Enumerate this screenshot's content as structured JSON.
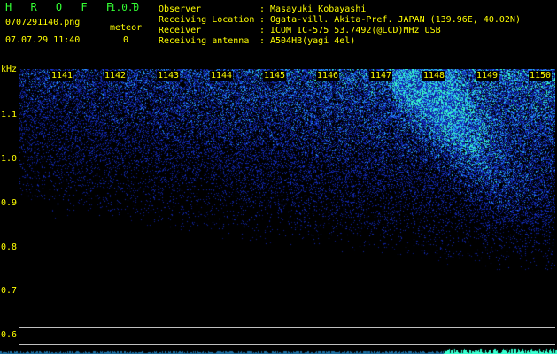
{
  "app": {
    "title": "H R O F F T",
    "version": "1.0.0"
  },
  "file": {
    "name": "0707291140.png",
    "datetime": "07.07.29 11:40"
  },
  "meteor": {
    "label": "meteor",
    "count": "0"
  },
  "info": [
    {
      "label": "Observer",
      "value": "Masayuki Kobayashi"
    },
    {
      "label": "Receiving Location",
      "value": "Ogata-vill. Akita-Pref. JAPAN (139.96E, 40.02N)"
    },
    {
      "label": "Receiver",
      "value": "ICOM IC-575 53.7492(@LCD)MHz USB"
    },
    {
      "label": "Receiving antenna",
      "value": "A504HB(yagi 4el)"
    }
  ],
  "separator": ":",
  "plot": {
    "unit": "kHz",
    "time_ticks": [
      "1141",
      "1142",
      "1143",
      "1144",
      "1145",
      "1146",
      "1147",
      "1148",
      "1149",
      "1150"
    ],
    "freq_ticks": [
      "1.1",
      "1.0",
      "0.9",
      "0.8",
      "0.7",
      "0.6"
    ]
  },
  "colors": {
    "background": "#000000",
    "text": "#ffff00",
    "title": "#33ff33",
    "signal_low": "#0a1aa0",
    "signal_mid": "#2e5cff",
    "signal_high": "#37ffd0",
    "gridline": "#bfbfbf"
  }
}
